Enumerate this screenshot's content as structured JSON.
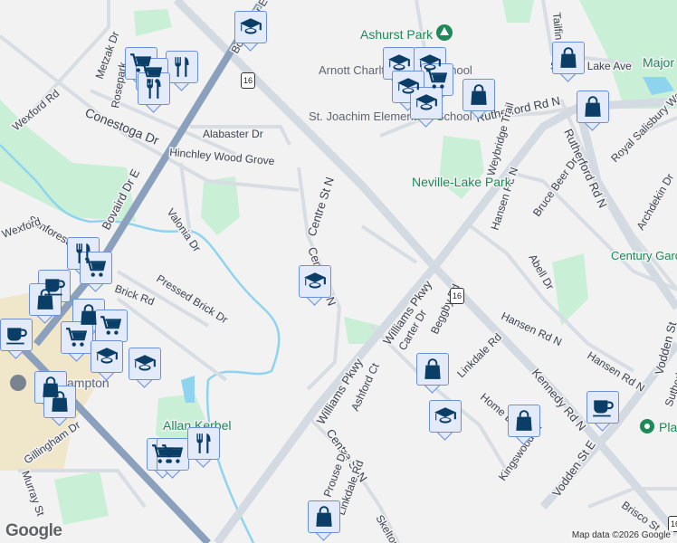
{
  "map": {
    "labels": [
      "Bovaird Dr E",
      "Metzak Dr",
      "Rosepark",
      "Wexford Rd",
      "Conestoga Dr",
      "Alabaster Dr",
      "Hinchley Wood Grove",
      "Bovaird Dr E",
      "Valonia Dr",
      "Sunforest Dr",
      "Centre St N",
      "Centre St N",
      "Brick Rd",
      "Pressed Brick Dr",
      "Rutherford Rd N",
      "Weybridge Trail",
      "Rutherford Rd N",
      "Royal Salisbury Way",
      "Hansen Rd N",
      "Bruce Beer Dr",
      "Archdekin Dr",
      "Abell Dr",
      "Hansen Rd N",
      "Hansen Rd N",
      "Williams Pkwy",
      "Williams Pkwy",
      "Carter Dr",
      "Beggby Rd",
      "Ashford Ct",
      "Linkdale Rd",
      "Home Dr",
      "Kennedy Rd N",
      "Kingswood Dr",
      "Vodden St E",
      "Centre St N",
      "Prouse Dr",
      "Linkdale Rd",
      "Skelton",
      "Gillingham Dr",
      "Murray St",
      "Brisco St",
      "Vodden St",
      "Sunset Lake Ave",
      "Tailfin",
      "Wexford",
      "Sutherland"
    ],
    "parks": [
      "Ashurst Park",
      "Neville-Lake Park",
      "Century Gardens Recreation Centre",
      "Major",
      "Allan Kerbel",
      "Plaza"
    ],
    "pois": [
      "Arnott Charlton Public School",
      "St. Joachim Elementary School",
      "Brampton"
    ],
    "route_shield": "16",
    "markers": [
      "school",
      "shopping-cart",
      "restaurant",
      "shopping-cart",
      "restaurant",
      "school",
      "school",
      "shopping-cart",
      "school",
      "school",
      "shopping-bag",
      "shopping-bag",
      "shopping-bag",
      "school",
      "restaurant",
      "shopping-cart",
      "cafe",
      "shopping-bag",
      "cafe",
      "shopping-bag",
      "shopping-cart",
      "shopping-cart",
      "school",
      "school",
      "shopping-bag",
      "shopping-bag",
      "shopping-cart",
      "shopping-cart",
      "restaurant",
      "shopping-bag",
      "school",
      "shopping-bag",
      "cafe",
      "shopping-bag"
    ],
    "attribution": "Map data ©2026 Google",
    "logo": "Google"
  },
  "colors": {
    "marker_fill": "#e3ebfb",
    "marker_border": "#6b8fd8",
    "icon": "#0b3e66",
    "park": "#c9f0d6",
    "water": "#8fd4ee"
  }
}
